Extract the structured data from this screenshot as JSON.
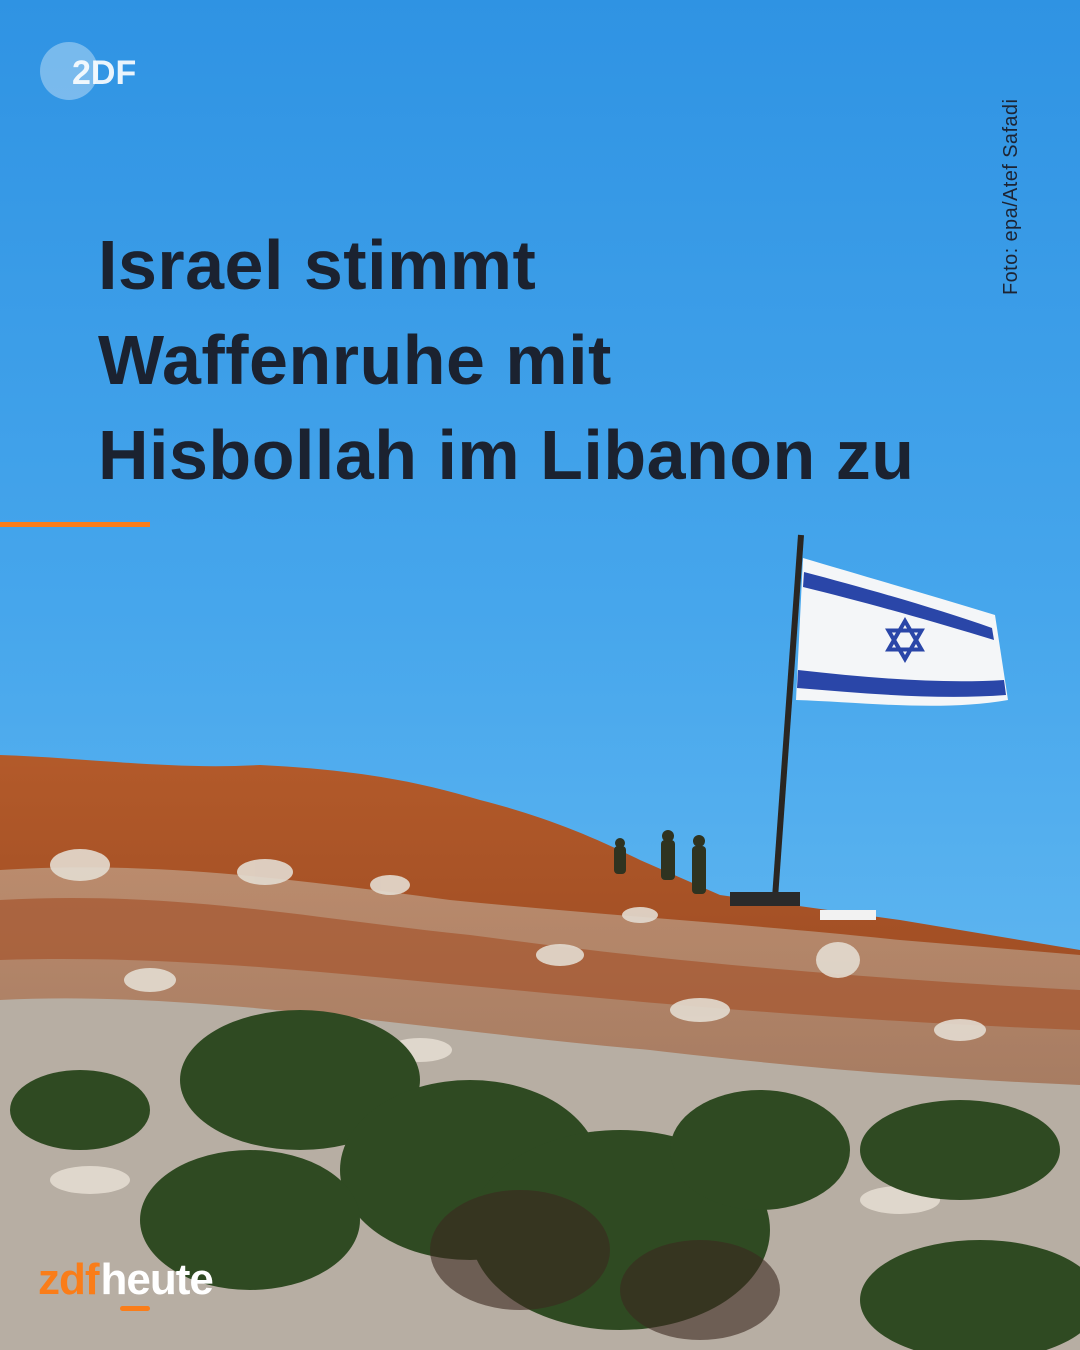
{
  "logo": {
    "text": "2DF",
    "icon": "zdf-circle-logo-icon",
    "color": "#ffffff"
  },
  "photo_credit": "Foto: epa/Atef Safadi",
  "headline": {
    "lines": [
      "Israel stimmt",
      "Waffenruhe mit",
      "Hisbollah im Libanon zu"
    ]
  },
  "brand": {
    "prefix": "zdf",
    "suffix": "heute"
  },
  "photo": {
    "subject": "israel-flag-on-hilltop",
    "flag_icon": "star-of-david-icon",
    "soldiers": 3
  },
  "colors": {
    "accent": "#fa7d19",
    "headline": "#1b2230",
    "sky": "#3f9fe6",
    "flag_blue": "#2a46a8",
    "soil": "#9a4a22"
  }
}
